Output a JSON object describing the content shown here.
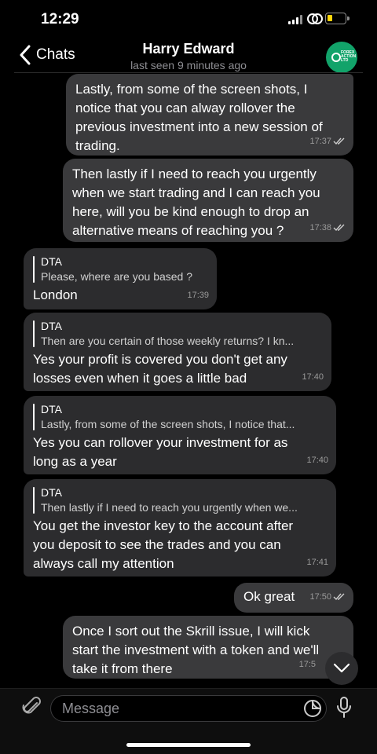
{
  "status": {
    "time": "12:29"
  },
  "header": {
    "back_label": "Chats",
    "title": "Harry Edward",
    "subtitle": "last seen 9 minutes ago",
    "avatar_text": "FOREX ACTION LTD"
  },
  "messages": [
    {
      "text": "Lastly, from some of the screen shots, I\nnotice that you can alway rollover the\nprevious investment into a new session of\ntrading.",
      "time": "17:37"
    },
    {
      "text": "Then lastly if I need to reach you urgently\nwhen we start trading and I can reach you\nhere, will you be kind enough to drop an\nalternative means of reaching you ?",
      "time": "17:38"
    },
    {
      "reply_name": "DTA",
      "reply_text": "Please, where are you based ?",
      "text": "London",
      "time": "17:39"
    },
    {
      "reply_name": "DTA",
      "reply_text": "Then are you certain of those weekly returns? I kn...",
      "text": "Yes your profit is covered you don't get any\nlosses even when it goes a little bad",
      "time": "17:40"
    },
    {
      "reply_name": "DTA",
      "reply_text": "Lastly, from some of the screen shots, I notice that...",
      "text": "Yes you can rollover your investment for as\nlong as a year",
      "time": "17:40"
    },
    {
      "reply_name": "DTA",
      "reply_text": "Then lastly if I need to reach you urgently when we...",
      "text": "You get the investor key to the account after\nyou deposit to see the trades and you can\nalways call my attention",
      "time": "17:41"
    },
    {
      "text": "Ok great",
      "time": "17:50"
    },
    {
      "text": "Once I sort out the Skrill issue, I will kick\nstart the investment with a token and we'll\ntake it from there",
      "time": "17:5"
    }
  ],
  "composer": {
    "placeholder": "Message"
  },
  "colors": {
    "outgoing_bubble": "#3a3a3c",
    "incoming_bubble": "#2c2c2e",
    "battery": "#ffd60a",
    "avatar": "#12a36a"
  }
}
